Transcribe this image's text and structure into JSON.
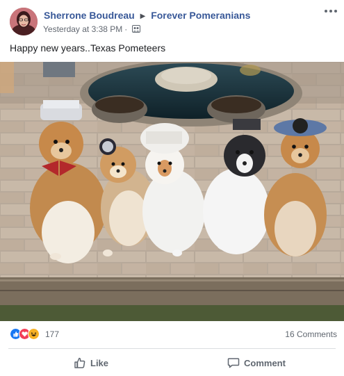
{
  "post": {
    "author": "Sherrone Boudreau",
    "group": "Forever Pomeranians",
    "timestamp": "Yesterday at 3:38 PM",
    "audience_icon": "group-audience-icon",
    "text": "Happy new years..Texas Pometeers"
  },
  "reactions": {
    "types": [
      "like",
      "love",
      "haha"
    ],
    "count": "177",
    "comments": "16 Comments"
  },
  "actions": {
    "like_label": "Like",
    "comment_label": "Comment"
  },
  "colors": {
    "brand_link": "#385898",
    "like_blue": "#1877f2",
    "love_red": "#f33e58",
    "haha_yellow": "#f7b125",
    "meta_gray": "#616770"
  }
}
